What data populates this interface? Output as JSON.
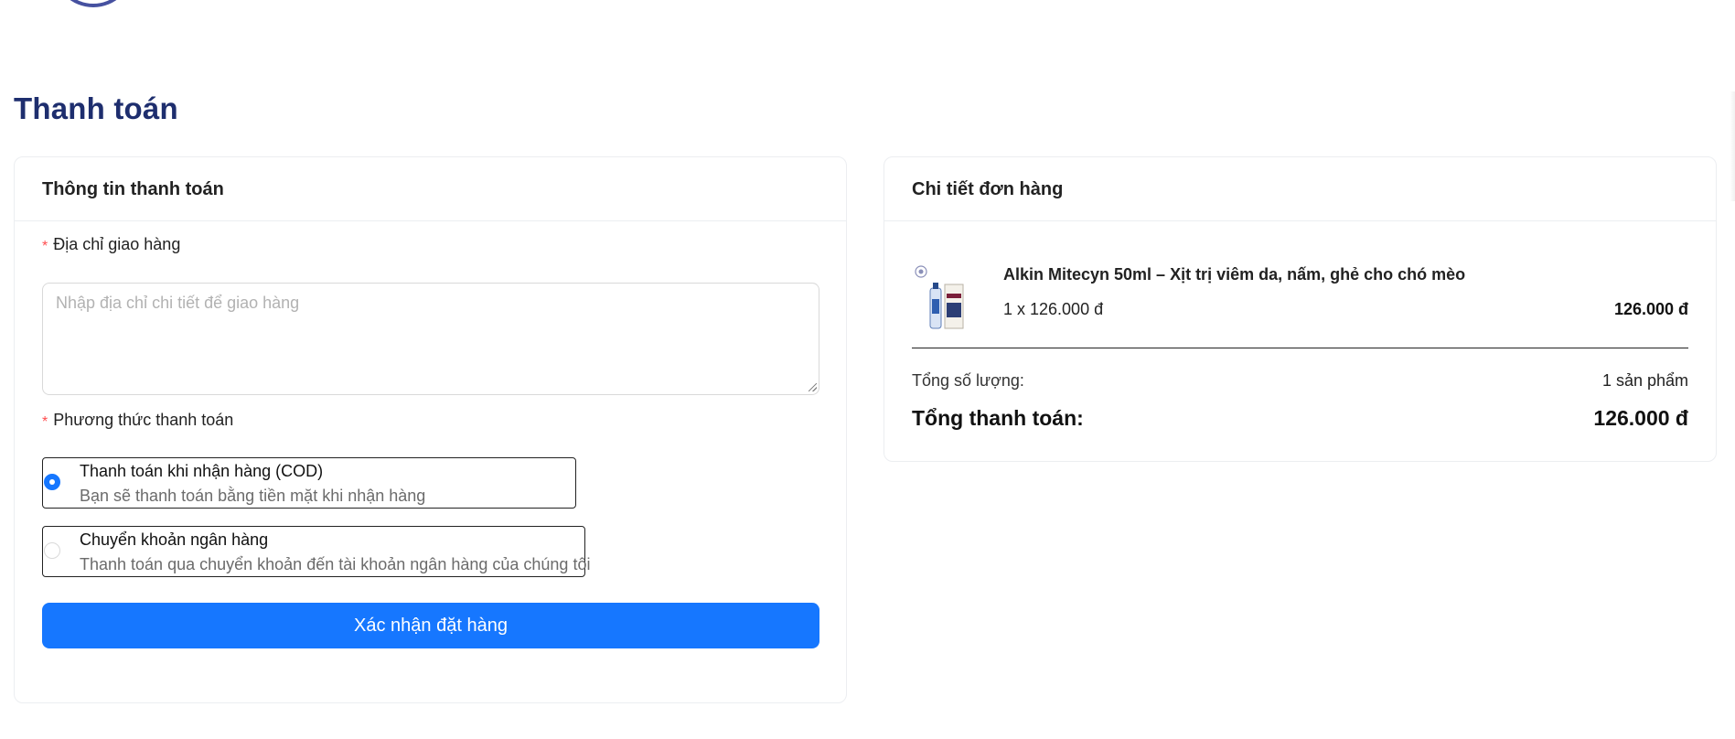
{
  "page": {
    "title": "Thanh toán"
  },
  "billing": {
    "header": "Thông tin thanh toán",
    "address": {
      "label": "Địa chỉ giao hàng",
      "required_mark": "*",
      "placeholder": "Nhập địa chỉ chi tiết để giao hàng",
      "value": ""
    },
    "payment": {
      "label": "Phương thức thanh toán",
      "required_mark": "*",
      "selected": "cod",
      "options": [
        {
          "id": "cod",
          "title": "Thanh toán khi nhận hàng (COD)",
          "description": "Bạn sẽ thanh toán bằng tiền mặt khi nhận hàng"
        },
        {
          "id": "bank",
          "title": "Chuyển khoản ngân hàng",
          "description": "Thanh toán qua chuyển khoản đến tài khoản ngân hàng của chúng tôi"
        }
      ]
    },
    "submit_label": "Xác nhận đặt hàng"
  },
  "order": {
    "header": "Chi tiết đơn hàng",
    "items": [
      {
        "name": "Alkin Mitecyn 50ml – Xịt trị viêm da, nấm, ghẻ cho chó mèo",
        "quantity_line": "1 x 126.000 đ",
        "line_total": "126.000 đ",
        "image": "product-spray-bottle"
      }
    ],
    "summary": {
      "quantity_label": "Tổng số lượng:",
      "quantity_value": "1 sản phẩm",
      "total_label": "Tổng thanh toán:",
      "total_value": "126.000 đ"
    }
  },
  "colors": {
    "primary": "#1677ff",
    "title": "#1e2e6e",
    "required": "#ff4d4f"
  }
}
